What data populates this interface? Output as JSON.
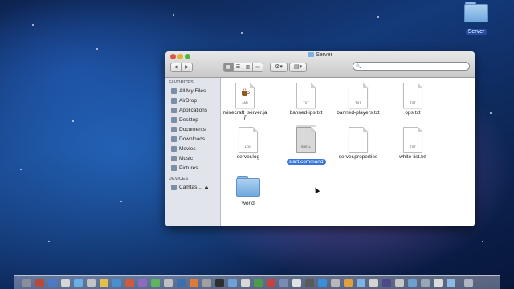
{
  "desktop": {
    "icon_label": "Server"
  },
  "window": {
    "title": "Server",
    "search_placeholder": ""
  },
  "toolbar": {
    "back": "◀",
    "forward": "▶",
    "view_icons": "▦",
    "view_list": "☰",
    "view_columns": "▥",
    "view_coverflow": "▭",
    "action": "⚙▾",
    "arrange": "▤▾",
    "search_icon": "🔍"
  },
  "sidebar": {
    "favorites_header": "FAVORITES",
    "favorites": [
      {
        "label": "All My Files",
        "icon": "all-files-icon"
      },
      {
        "label": "AirDrop",
        "icon": "airdrop-icon"
      },
      {
        "label": "Applications",
        "icon": "applications-icon"
      },
      {
        "label": "Desktop",
        "icon": "desktop-icon"
      },
      {
        "label": "Documents",
        "icon": "documents-icon"
      },
      {
        "label": "Downloads",
        "icon": "downloads-icon"
      },
      {
        "label": "Movies",
        "icon": "movies-icon"
      },
      {
        "label": "Music",
        "icon": "music-icon"
      },
      {
        "label": "Pictures",
        "icon": "pictures-icon"
      }
    ],
    "devices_header": "DEVICES",
    "devices": [
      {
        "label": "Camtas...",
        "eject": "⏏",
        "icon": "disk-icon"
      }
    ]
  },
  "files": [
    {
      "name": "minecraft_server.jar",
      "name_l1": "minecraft_server.ja",
      "name_l2": "r",
      "type": "JAR"
    },
    {
      "name": "banned-ips.txt",
      "type": "TXT"
    },
    {
      "name": "banned-players.txt",
      "type": "TXT"
    },
    {
      "name": "ops.txt",
      "type": "TXT"
    },
    {
      "name": "server.log",
      "type": "LOG"
    },
    {
      "name": "start.command",
      "type": "SHELL",
      "selected": true
    },
    {
      "name": "server.properties",
      "type": ""
    },
    {
      "name": "white-list.txt",
      "type": "TXT"
    },
    {
      "name": "world",
      "type": "folder"
    }
  ]
}
